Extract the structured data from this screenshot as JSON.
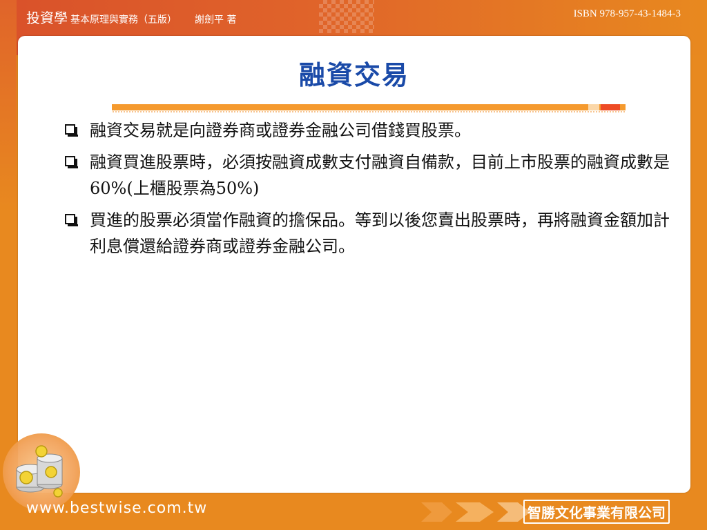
{
  "header": {
    "book_title": "投資學",
    "subtitle": "基本原理與實務（五版）",
    "author": "謝劍平 著",
    "isbn": "ISBN 978-957-43-1484-3"
  },
  "slide": {
    "title": "融資交易",
    "bullets": [
      "融資交易就是向證券商或證券金融公司借錢買股票。",
      "融資買進股票時，必須按融資成數支付融資自備款，目前上市股票的融資成數是60%(上櫃股票為50%)",
      "買進的股票必須當作融資的擔保品。等到以後您賣出股票時，再將融資金額加計利息償還給證券商或證券金融公司。"
    ]
  },
  "footer": {
    "url": "www.bestwise.com.tw",
    "company": "智勝文化事業有限公司"
  },
  "icons": [
    "coins-icon",
    "arrow-icon",
    "checkbox-bullet-icon"
  ],
  "colors": {
    "accent_orange": "#e8891f",
    "title_blue": "#1a4aa8",
    "header_red": "#d9512a"
  }
}
